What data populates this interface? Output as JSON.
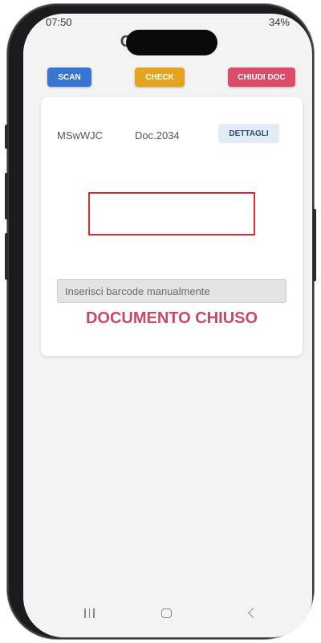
{
  "status_bar": {
    "time": "07:50",
    "battery": "34%"
  },
  "header": {
    "title": "CA          NE"
  },
  "toolbar": {
    "scan_label": "SCAN",
    "check_label": "CHECK",
    "chiudi_label": "CHIUDI DOC"
  },
  "document": {
    "code": "MSwWJC",
    "doc_number": "Doc.2034",
    "details_label": "DETTAGLI"
  },
  "barcode": {
    "placeholder": "Inserisci barcode manualmente",
    "value": ""
  },
  "status_message": "DOCUMENTO CHIUSO",
  "colors": {
    "scan": "#3a74d1",
    "check": "#e6a31f",
    "chiudi": "#dc4b68",
    "closed_text": "#c84866",
    "scan_frame": "#d22f2f"
  }
}
